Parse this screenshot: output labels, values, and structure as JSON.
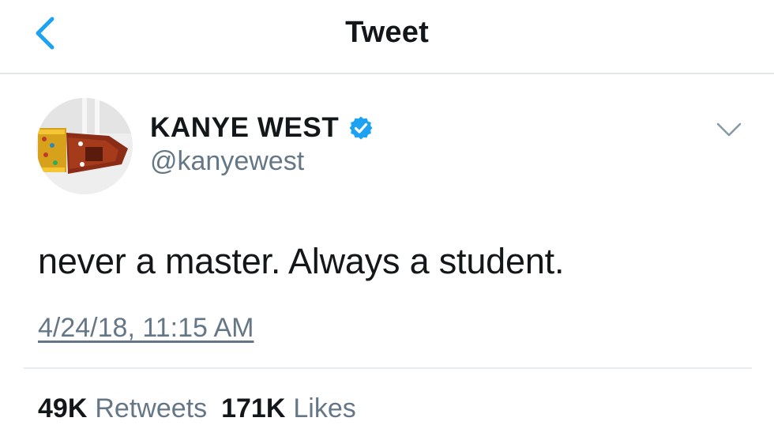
{
  "header": {
    "title": "Tweet",
    "back_icon": "chevron-left-icon"
  },
  "colors": {
    "accent": "#1da1f2",
    "text_primary": "#14171a",
    "text_secondary": "#657786",
    "divider": "#e1e6ea"
  },
  "tweet": {
    "author": {
      "display_name": "KANYE WEST",
      "handle": "@kanyewest",
      "verified": true,
      "avatar_icon": "avatar-image"
    },
    "menu_icon": "chevron-down-icon",
    "text": "never a master. Always a student.",
    "timestamp": "4/24/18, 11:15 AM",
    "stats": [
      {
        "count": "49K",
        "label": "Retweets"
      },
      {
        "count": "171K",
        "label": "Likes"
      }
    ]
  }
}
